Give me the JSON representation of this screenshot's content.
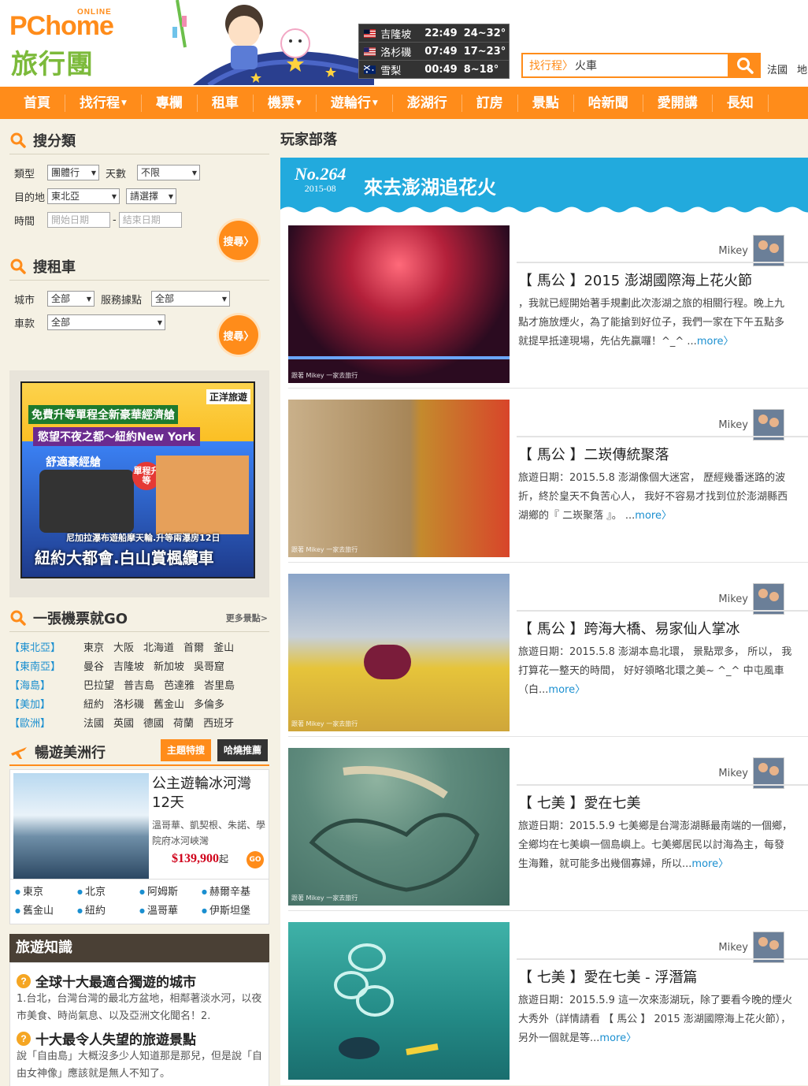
{
  "header": {
    "logo_main": "PChome",
    "logo_online": "ONLINE",
    "logo_sub": "旅行團",
    "weather": [
      {
        "flag": "malaysia",
        "city": "吉隆坡",
        "time": "22:49",
        "temp": "24~32°"
      },
      {
        "flag": "usa",
        "city": "洛杉磯",
        "time": "07:49",
        "temp": "17~23°"
      },
      {
        "flag": "australia",
        "city": "雪梨",
        "time": "00:49",
        "temp": "8~18°"
      }
    ],
    "search_crumb": "找行程",
    "search_value": "火車",
    "region_links": [
      "法國",
      "地"
    ]
  },
  "nav": {
    "items": [
      {
        "label": "首頁",
        "caret": ""
      },
      {
        "label": "找行程",
        "caret": "▼"
      },
      {
        "label": "專欄",
        "caret": ""
      },
      {
        "label": "租車",
        "caret": ""
      },
      {
        "label": "機票",
        "caret": "▼"
      },
      {
        "label": "遊輪行",
        "caret": "▼"
      },
      {
        "label": "澎湖行",
        "caret": ""
      },
      {
        "label": "訂房",
        "caret": ""
      },
      {
        "label": "景點",
        "caret": ""
      },
      {
        "label": "哈新聞",
        "caret": ""
      },
      {
        "label": "愛開講",
        "caret": ""
      },
      {
        "label": "長知",
        "caret": ""
      }
    ]
  },
  "search_category": {
    "title": "搜分類",
    "type_label": "類型",
    "type_value": "團體行",
    "days_label": "天數",
    "days_value": "不限",
    "dest_label": "目的地",
    "dest_value": "東北亞",
    "dest_sub_value": "請選擇",
    "time_label": "時間",
    "start_placeholder": "開始日期",
    "dash": "-",
    "end_placeholder": "結束日期",
    "button": "搜尋〉"
  },
  "search_car": {
    "title": "搜租車",
    "city_label": "城市",
    "city_value": "全部",
    "station_label": "服務據點",
    "station_value": "全部",
    "model_label": "車款",
    "model_value": "全部",
    "button": "搜尋〉"
  },
  "ad": {
    "brand": "正洋旅遊",
    "line1": "免費升等單程全新豪華經濟艙",
    "line2": "慾望不夜之都～紐約New York",
    "line3": "舒適豪經艙",
    "badge": "單程升等",
    "line4": "尼加拉瀑布遊船摩天輪.升等兩瀑房12日",
    "line5": "紐約大都會.白山賞楓纜車"
  },
  "tickets": {
    "title": "一張機票就GO",
    "more": "更多景點>",
    "rows": [
      {
        "region": "【東北亞】",
        "cities": [
          "東京",
          "大阪",
          "北海道",
          "首爾",
          "釜山"
        ]
      },
      {
        "region": "【東南亞】",
        "cities": [
          "曼谷",
          "吉隆坡",
          "新加坡",
          "吳哥窟"
        ]
      },
      {
        "region": "【海島】",
        "cities": [
          "巴拉望",
          "普吉島",
          "芭達雅",
          "峇里島"
        ]
      },
      {
        "region": "【美加】",
        "cities": [
          "紐約",
          "洛杉磯",
          "舊金山",
          "多倫多"
        ]
      },
      {
        "region": "【歐洲】",
        "cities": [
          "法國",
          "英國",
          "德國",
          "荷蘭",
          "西班牙"
        ]
      }
    ]
  },
  "america": {
    "title": "暢遊美洲行",
    "tab1": "主題特搜",
    "tab2": "哈燒推薦",
    "tour_title": "公主遊輪冰河灣12天",
    "tour_desc": "溫哥華、凱契根、朱諾、學院府冰河峽灣",
    "price": "$139,900",
    "price_suffix": "起",
    "go": "GO",
    "destinations": [
      "東京",
      "北京",
      "阿姆斯",
      "赫爾辛基",
      "舊金山",
      "紐約",
      "溫哥華",
      "伊斯坦堡"
    ]
  },
  "knowledge": {
    "title": "旅遊知識",
    "items": [
      {
        "q": "全球十大最適合獨遊的城市",
        "text": "1.台北，台灣台灣的最北方盆地，相鄰著淡水河，以夜市美食、時尚氣息、以及亞洲文化聞名！2."
      },
      {
        "q": "十大最令人失望的旅遊景點",
        "text": "說「自由島」大概沒多少人知道那是那兒，但是說「自由女神像」應該就是無人不知了。"
      }
    ]
  },
  "blog": {
    "section_title": "玩家部落",
    "issue_no": "No.264",
    "issue_date": "2015-08",
    "banner_title": "來去澎湖追花火",
    "posts": [
      {
        "author": "Mikey",
        "title": "【 馬公 】2015 澎湖國際海上花火節",
        "desc": "，我就已經開始著手規劃此次澎湖之旅的相關行程。晚上九點才施放煙火，為了能搶到好位子，我們一家在下午五點多就提早抵達現場，先佔先贏囉！^_^ ...",
        "more": "more〉",
        "watermark": "跟著 Mikey 一家去旅行"
      },
      {
        "author": "Mikey",
        "title": "【 馬公 】二崁傳統聚落",
        "desc": "旅遊日期：2015.5.8 澎湖像個大迷宮， 歷經幾番迷路的波折，終於皇天不負苦心人， 我好不容易才找到位於澎湖縣西湖鄉的『 二崁聚落 』。 ...",
        "more": "more〉",
        "watermark": "跟著 Mikey 一家去旅行"
      },
      {
        "author": "Mikey",
        "title": "【 馬公 】跨海大橋、易家仙人掌冰",
        "desc": "旅遊日期：2015.5.8 澎湖本島北環， 景點眾多， 所以， 我打算花一整天的時間， 好好領略北環之美~ ^_^ 中屯風車（白...",
        "more": "more〉",
        "watermark": "跟著 Mikey 一家去旅行"
      },
      {
        "author": "Mikey",
        "title": "【 七美 】愛在七美",
        "desc": "旅遊日期：2015.5.9 七美鄉是台灣澎湖縣最南端的一個鄉，全鄉均在七美嶼一個島嶼上。七美鄉居民以討海為主，每發生海難，就可能多出幾個寡婦，所以...",
        "more": "more〉",
        "watermark": "跟著 Mikey 一家去旅行"
      },
      {
        "author": "Mikey",
        "title": "【 七美 】愛在七美 - 浮潛篇",
        "desc": "旅遊日期：2015.5.9 這一次來澎湖玩，除了要看今晚的煙火大秀外（詳情請看 【 馬公 】 2015 澎湖國際海上花火節），另外一個就是等...",
        "more": "more〉",
        "watermark": ""
      }
    ]
  },
  "colors": {
    "accent": "#ff8c1a",
    "blue": "#22aadd",
    "link": "#1a8fd0"
  }
}
